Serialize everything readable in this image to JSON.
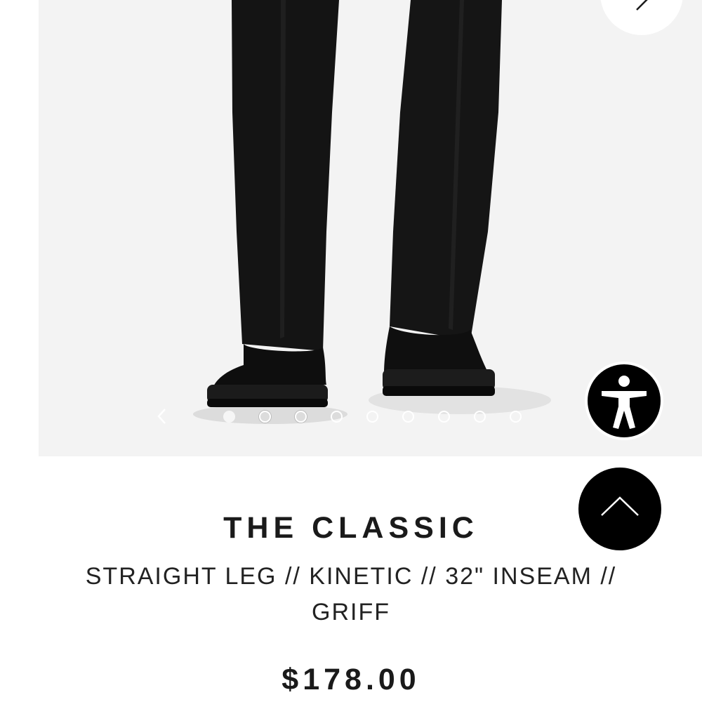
{
  "product": {
    "title": "THE CLASSIC",
    "subtitle": "STRAIGHT LEG // KINETIC // 32\" INSEAM // GRIFF",
    "price": "$178.00"
  },
  "carousel": {
    "slide_count": 9,
    "active_index": 0,
    "prev_icon": "chevron-left-icon",
    "next_icon": "chevron-right-icon"
  },
  "icons": {
    "zoom": "expand-arrow-icon",
    "accessibility": "accessibility-person-icon",
    "scroll_top": "chevron-up-icon"
  },
  "colors": {
    "image_background": "#f3f3f3",
    "text": "#1a1a1a",
    "button_dark": "#000000"
  }
}
